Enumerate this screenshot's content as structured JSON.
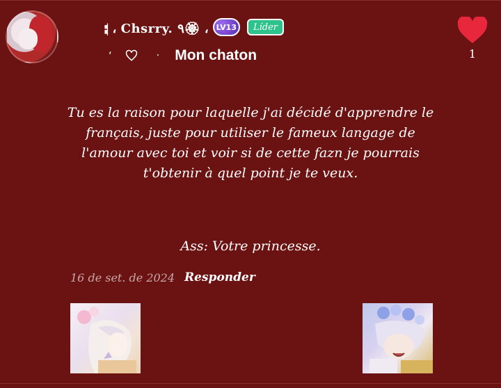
{
  "comment": {
    "author": {
      "username": "𝇠 ، Chsrry. ٩🏵 ،",
      "level": "LV13",
      "role": "Líder"
    },
    "subtitle_deco_left": "‘",
    "subtitle_deco_mid": "·",
    "subtitle": "Mon chaton",
    "likes": {
      "count": "1",
      "color": "#e8263c"
    },
    "message": "Tu es la raison pour laquelle j'ai décidé d'apprendre le français, juste pour utiliser le fameux langage de l'amour avec toi et voir si de cette fazn je pourrais t'obtenir à quel point je te veux.",
    "signature": "Ass:  Votre princesse.",
    "date": "16 de set. de 2024",
    "reply_label": "Responder"
  },
  "colors": {
    "background": "#6b1212",
    "role_badge": "#2fc38c",
    "level_badge": "#6a3ac4",
    "date_text": "#c9a7a7"
  },
  "icons": {
    "like": "heart-filled-icon",
    "subtitle": "heart-outline-icon"
  }
}
